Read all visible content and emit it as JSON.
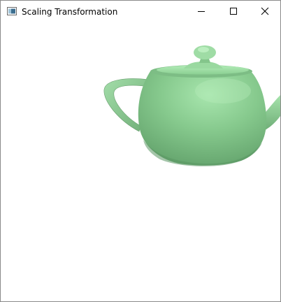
{
  "window": {
    "title": "Scaling Transformation",
    "controls": {
      "minimize": "minimize",
      "maximize": "maximize",
      "close": "close"
    }
  },
  "scene": {
    "object": "teapot",
    "object_color": "#86c98d",
    "highlight_color": "#a8e6ae",
    "shadow_color": "#5f9e68",
    "background_color": "#ffffff"
  }
}
